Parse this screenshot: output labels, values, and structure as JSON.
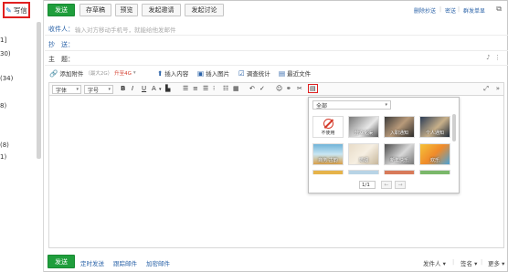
{
  "sidebar": {
    "compose_label": "写信",
    "counts": [
      "1]",
      "30)",
      "(34)",
      "8)",
      "(8)",
      "1)"
    ]
  },
  "toolbar": {
    "send": "发送",
    "draft": "存草稿",
    "preview": "预览",
    "invite": "发起邀请",
    "discuss": "发起讨论",
    "delete_cc": "删除抄送",
    "bcc": "密送",
    "group_send": "群发单显"
  },
  "fields": {
    "to_label": "收件人：",
    "to_placeholder": "输入对方移动手机号，就能给他发邮件",
    "cc_label": "抄　送：",
    "subject_label": "主　题："
  },
  "attach": {
    "add_attachment": "添加附件",
    "max_size": "（最大2G）",
    "upgrade": "升至4G",
    "insert_content": "插入内容",
    "insert_image": "插入图片",
    "survey": "调查统计",
    "recent_files": "最近文件"
  },
  "editor": {
    "font_label": "字体",
    "size_label": "字号"
  },
  "stationery": {
    "category": "全部",
    "items": [
      "不使用",
      "分众化渠",
      "入职通知",
      "个人通知",
      "商务·古韵",
      "婚姻",
      "新年快乐",
      "欢乐"
    ],
    "page": "1/1"
  },
  "bottom": {
    "send": "发送",
    "scheduled": "定时发送",
    "track": "跟踪邮件",
    "encrypt": "加密邮件",
    "sender": "发件人",
    "signature": "签名",
    "more": "更多"
  },
  "colors": {
    "primary_green": "#1f9e3c",
    "link_blue": "#2b63a8",
    "highlight_red": "#e02020"
  }
}
